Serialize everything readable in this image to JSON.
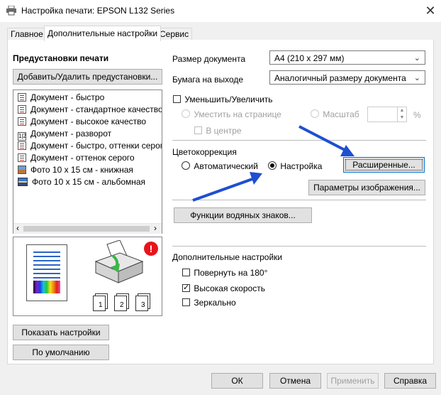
{
  "window": {
    "title": "Настройка печати: EPSON L132 Series",
    "close_glyph": "✕"
  },
  "tabs": [
    {
      "label": "Главное"
    },
    {
      "label": "Дополнительные настройки"
    },
    {
      "label": "Сервис"
    }
  ],
  "presets": {
    "heading": "Предустановки печати",
    "add_remove_button": "Добавить/Удалить предустановки...",
    "items": [
      {
        "label": "Документ - быстро",
        "icon": "document-icon"
      },
      {
        "label": "Документ - стандартное качество",
        "icon": "document-icon"
      },
      {
        "label": "Документ - высокое качество",
        "icon": "document-icon"
      },
      {
        "label": "Документ - разворот",
        "icon": "duplex-icon"
      },
      {
        "label": "Документ - быстро, оттенки серого",
        "icon": "document-icon"
      },
      {
        "label": "Документ - оттенок серого",
        "icon": "document-icon"
      },
      {
        "label": "Фото 10 х 15 см - книжная",
        "icon": "photo-portrait-icon"
      },
      {
        "label": "Фото 10 х 15 см - альбомная",
        "icon": "photo-landscape-icon"
      }
    ],
    "scroll_left": "‹",
    "scroll_right": "›"
  },
  "preview": {
    "alert_glyph": "!",
    "collate_labels": [
      "1",
      "2",
      "3"
    ]
  },
  "left_buttons": {
    "show_settings": "Показать настройки",
    "defaults": "По умолчанию"
  },
  "document": {
    "size_label": "Размер документа",
    "size_value": "A4 (210 x 297 мм)",
    "output_label": "Бумага на выходе",
    "output_value": "Аналогичный размеру документа"
  },
  "scaling": {
    "reduce_enlarge_label": "Уменьшить/Увеличить",
    "fit_page_label": "Уместить на странице",
    "scale_label": "Масштаб",
    "percent_sign": "%",
    "center_label": "В центре"
  },
  "color_correction": {
    "heading": "Цветокоррекция",
    "auto_label": "Автоматический",
    "custom_label": "Настройка",
    "advanced_button": "Расширенные...",
    "image_params_button": "Параметры изображения..."
  },
  "watermark_button": "Функции водяных знаков...",
  "extra": {
    "heading": "Дополнительные настройки",
    "rotate_label": "Повернуть на 180°",
    "high_speed_label": "Высокая скорость",
    "mirror_label": "Зеркально"
  },
  "footer": {
    "ok": "ОК",
    "cancel": "Отмена",
    "apply": "Применить",
    "help": "Справка"
  },
  "colors": {
    "arrow": "#1f4fd1",
    "focus": "#0078d7",
    "alert": "#e8141b"
  }
}
